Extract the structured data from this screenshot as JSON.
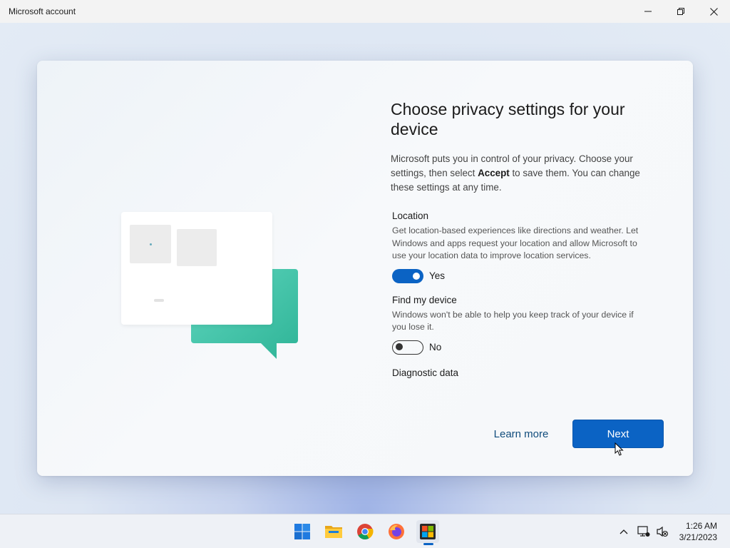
{
  "window": {
    "title": "Microsoft account",
    "minimize_icon": "minimize-icon",
    "restore_icon": "restore-icon",
    "close_icon": "close-icon"
  },
  "page": {
    "heading": "Choose privacy settings for your device",
    "intro_part1": "Microsoft puts you in control of your privacy. Choose your settings, then select ",
    "intro_bold": "Accept",
    "intro_part2": " to save them. You can change these settings at any time."
  },
  "settings": {
    "location": {
      "title": "Location",
      "description": "Get location-based experiences like directions and weather. Let Windows and apps request your location and allow Microsoft to use your location data to improve location services.",
      "state": "Yes"
    },
    "find_my_device": {
      "title": "Find my device",
      "description": "Windows won't be able to help you keep track of your device if you lose it.",
      "state": "No"
    },
    "diagnostic": {
      "title": "Diagnostic data"
    }
  },
  "buttons": {
    "learn_more": "Learn more",
    "next": "Next"
  },
  "taskbar": {
    "icons": [
      "start-icon",
      "file-explorer-icon",
      "chrome-icon",
      "firefox-icon",
      "microsoft-store-icon"
    ],
    "time": "1:26 AM",
    "date": "3/21/2023"
  },
  "colors": {
    "accent": "#0b63c4",
    "bubble": "#3ec3a8"
  }
}
